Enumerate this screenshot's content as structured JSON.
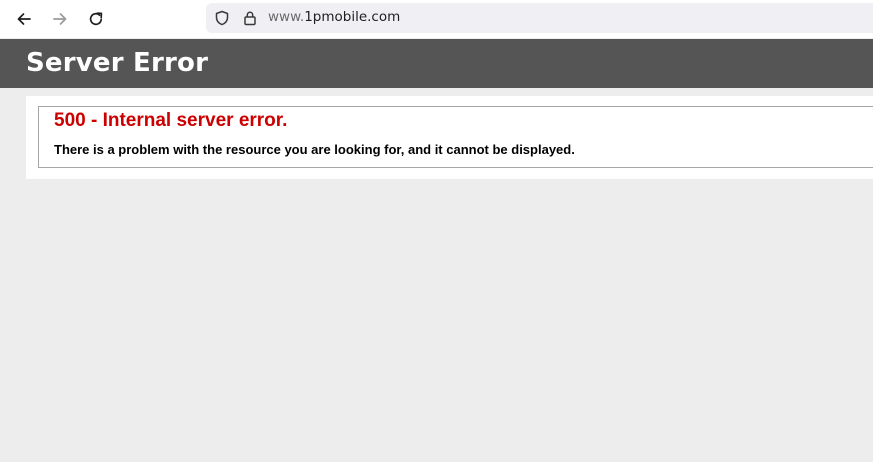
{
  "browser": {
    "url_prefix": "www.",
    "url_host": "1pmobile.com",
    "icons": [
      "back-arrow-icon",
      "forward-arrow-icon",
      "reload-icon",
      "shield-icon",
      "lock-icon"
    ]
  },
  "page": {
    "title": "Server Error",
    "error_heading": "500 - Internal server error.",
    "error_message": "There is a problem with the resource you are looking for, and it cannot be displayed."
  },
  "colors": {
    "header_bg": "#555555",
    "error_heading": "#cc0000",
    "page_bg": "#ededed"
  }
}
